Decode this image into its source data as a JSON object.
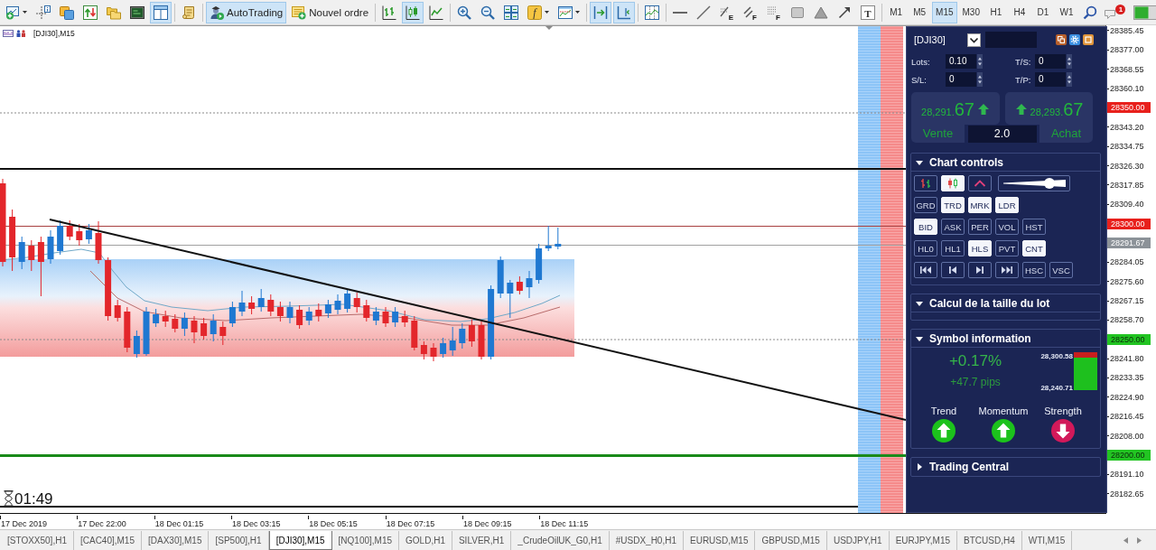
{
  "toolbar": {
    "groups": [
      [
        {
          "kind": "menu",
          "selected": false
        },
        {
          "kind": "icon",
          "selected": false
        },
        {
          "kind": "icon",
          "selected": false
        },
        {
          "kind": "icon",
          "selected": false
        },
        {
          "kind": "icon",
          "selected": false
        },
        {
          "kind": "icon",
          "selected": false
        },
        {
          "kind": "icon",
          "selected": true
        }
      ],
      [
        {
          "kind": "icon",
          "selected": false
        }
      ],
      [
        {
          "kind": "button",
          "label": "AutoTrading",
          "selected": true
        },
        {
          "kind": "button",
          "label": "Nouvel ordre",
          "selected": false
        }
      ],
      [
        {
          "kind": "icon",
          "selected": false
        },
        {
          "kind": "icon",
          "selected": true
        },
        {
          "kind": "icon",
          "selected": false
        }
      ],
      [
        {
          "kind": "icon",
          "selected": false
        },
        {
          "kind": "icon",
          "selected": false
        },
        {
          "kind": "icon",
          "selected": false
        },
        {
          "kind": "menu",
          "letter": "f",
          "selected": false
        },
        {
          "kind": "menu",
          "selected": false
        }
      ],
      [
        {
          "kind": "icon",
          "selected": true
        },
        {
          "kind": "icon",
          "selected": true
        }
      ],
      [
        {
          "kind": "icon",
          "selected": false
        }
      ],
      [
        {
          "kind": "icon",
          "selected": false
        },
        {
          "kind": "icon",
          "selected": false
        },
        {
          "kind": "icon",
          "letter": "E",
          "selected": false
        },
        {
          "kind": "icon",
          "letter": "F",
          "selected": false
        },
        {
          "kind": "icon",
          "letter": "F",
          "selected": false
        },
        {
          "kind": "icon",
          "selected": false
        },
        {
          "kind": "icon",
          "selected": false
        },
        {
          "kind": "icon",
          "selected": false
        },
        {
          "kind": "icon",
          "letter": "T",
          "selected": false
        }
      ],
      [
        {
          "kind": "timeframe",
          "label": "M1",
          "selected": false
        },
        {
          "kind": "timeframe",
          "label": "M5",
          "selected": false
        },
        {
          "kind": "timeframe",
          "label": "M15",
          "selected": true
        },
        {
          "kind": "timeframe",
          "label": "M30",
          "selected": false
        },
        {
          "kind": "timeframe",
          "label": "H1",
          "selected": false
        },
        {
          "kind": "timeframe",
          "label": "H4",
          "selected": false
        },
        {
          "kind": "timeframe",
          "label": "D1",
          "selected": false
        },
        {
          "kind": "timeframe",
          "label": "W1",
          "selected": false
        },
        {
          "kind": "icon",
          "selected": false
        },
        {
          "kind": "alert",
          "badge": "1"
        },
        {
          "kind": "status"
        }
      ]
    ]
  },
  "chart": {
    "title": "[DJI30],M15",
    "timer": "01:49",
    "price_axis": [
      {
        "kind": "tick",
        "label": "28385.45"
      },
      {
        "kind": "tick",
        "label": "28377.00"
      },
      {
        "kind": "tick",
        "label": "28368.55"
      },
      {
        "kind": "tick",
        "label": "28360.10"
      },
      {
        "kind": "tag",
        "label": "28350.00",
        "color": "#e8201c"
      },
      {
        "kind": "tick",
        "label": "28343.20"
      },
      {
        "kind": "tick",
        "label": "28334.75"
      },
      {
        "kind": "tick",
        "label": "28326.30"
      },
      {
        "kind": "tick",
        "label": "28317.85"
      },
      {
        "kind": "tick",
        "label": "28309.40"
      },
      {
        "kind": "tag",
        "label": "28300.00",
        "color": "#e8201c"
      },
      {
        "kind": "tag",
        "label": "28291.67",
        "color": "#8c9298"
      },
      {
        "kind": "tick",
        "label": "28284.05"
      },
      {
        "kind": "tick",
        "label": "28275.60"
      },
      {
        "kind": "tick",
        "label": "28267.15"
      },
      {
        "kind": "tick",
        "label": "28258.70"
      },
      {
        "kind": "tag",
        "label": "28250.00",
        "color": "#22c422"
      },
      {
        "kind": "tick",
        "label": "28241.80"
      },
      {
        "kind": "tick",
        "label": "28233.35"
      },
      {
        "kind": "tick",
        "label": "28224.90"
      },
      {
        "kind": "tick",
        "label": "28216.45"
      },
      {
        "kind": "tick",
        "label": "28208.00"
      },
      {
        "kind": "tag",
        "label": "28200.00",
        "color": "#22c422"
      },
      {
        "kind": "tick",
        "label": "28191.10"
      },
      {
        "kind": "tick",
        "label": "28182.65"
      }
    ],
    "time_axis": [
      "17 Dec 2019",
      "17 Dec 22:00",
      "18 Dec 01:15",
      "18 Dec 03:15",
      "18 Dec 05:15",
      "18 Dec 07:15",
      "18 Dec 09:15",
      "18 Dec 11:15"
    ]
  },
  "panel": {
    "symbol": "[DJI30]",
    "fields": [
      {
        "label": "Lots:",
        "value": "0.10"
      },
      {
        "label": "T/S:",
        "value": "0"
      },
      {
        "label": "S/L:",
        "value": "0"
      },
      {
        "label": "T/P:",
        "value": "0"
      }
    ],
    "quotes": [
      {
        "price": "28,291.**67**",
        "kind": "up",
        "label": "Vente"
      },
      {
        "price": "28,293.**67**",
        "kind": "up",
        "label": "Achat"
      }
    ],
    "spread": "2.0",
    "sections": [
      {
        "kind": "controls",
        "title": "Chart controls",
        "expanded": true,
        "rows": [
          [
            {
              "kind": "icon",
              "selected": false
            },
            {
              "kind": "icon",
              "selected": true
            },
            {
              "kind": "icon",
              "selected": false
            },
            {
              "kind": "slider",
              "level": 0.76
            }
          ],
          [
            {
              "kind": "text",
              "label": "GRD",
              "selected": false
            },
            {
              "kind": "text",
              "label": "TRD",
              "selected": true
            },
            {
              "kind": "text",
              "label": "MRK",
              "selected": true
            },
            {
              "kind": "text",
              "label": "LDR",
              "selected": true
            }
          ],
          [
            {
              "kind": "text",
              "label": "BID",
              "selected": true
            },
            {
              "kind": "text",
              "label": "ASK",
              "selected": false
            },
            {
              "kind": "text",
              "label": "PER",
              "selected": false
            },
            {
              "kind": "text",
              "label": "VOL",
              "selected": false
            },
            {
              "kind": "text",
              "label": "HST",
              "selected": false
            }
          ],
          [
            {
              "kind": "text",
              "label": "HL0",
              "selected": false
            },
            {
              "kind": "text",
              "label": "HL1",
              "selected": false
            },
            {
              "kind": "text",
              "label": "HLS",
              "selected": true
            },
            {
              "kind": "text",
              "label": "PVT",
              "selected": false
            },
            {
              "kind": "text",
              "label": "CNT",
              "selected": true
            }
          ],
          [
            {
              "kind": "icon",
              "selected": false
            },
            {
              "kind": "icon",
              "selected": false
            },
            {
              "kind": "icon",
              "selected": false
            },
            {
              "kind": "icon",
              "selected": false
            },
            {
              "kind": "text",
              "label": "HSC",
              "selected": false
            },
            {
              "kind": "text",
              "label": "VSC",
              "selected": false
            }
          ]
        ]
      },
      {
        "kind": "lot",
        "title": "Calcul de la taille du lot",
        "expanded": true
      },
      {
        "kind": "symbol",
        "title": "Symbol information",
        "expanded": true,
        "change": "+0.17%",
        "pips": "+47.7 pips",
        "high": "28,300.58",
        "low": "28,240.71",
        "range": {
          "level": 0.85
        },
        "indicators": [
          {
            "label": "Trend",
            "kind": "up"
          },
          {
            "label": "Momentum",
            "kind": "up"
          },
          {
            "label": "Strength",
            "kind": "down"
          }
        ]
      },
      {
        "title": "Trading Central",
        "expanded": false
      }
    ]
  },
  "tabs": [
    {
      "label": "[STOXX50],H1",
      "selected": false
    },
    {
      "label": "[CAC40],M15",
      "selected": false
    },
    {
      "label": "[DAX30],M15",
      "selected": false
    },
    {
      "label": "[SP500],H1",
      "selected": false
    },
    {
      "label": "[DJI30],M15",
      "selected": true
    },
    {
      "label": "[NQ100],M15",
      "selected": false
    },
    {
      "label": "GOLD,H1",
      "selected": false
    },
    {
      "label": "SILVER,H1",
      "selected": false
    },
    {
      "label": "_CrudeOilUK_G0,H1",
      "selected": false
    },
    {
      "label": "#USDX_H0,H1",
      "selected": false
    },
    {
      "label": "EURUSD,M15",
      "selected": false
    },
    {
      "label": "GBPUSD,M15",
      "selected": false
    },
    {
      "label": "USDJPY,H1",
      "selected": false
    },
    {
      "label": "EURJPY,M15",
      "selected": false
    },
    {
      "label": "BTCUSD,H4",
      "selected": false
    },
    {
      "label": "WTI,M15",
      "selected": false
    }
  ]
}
